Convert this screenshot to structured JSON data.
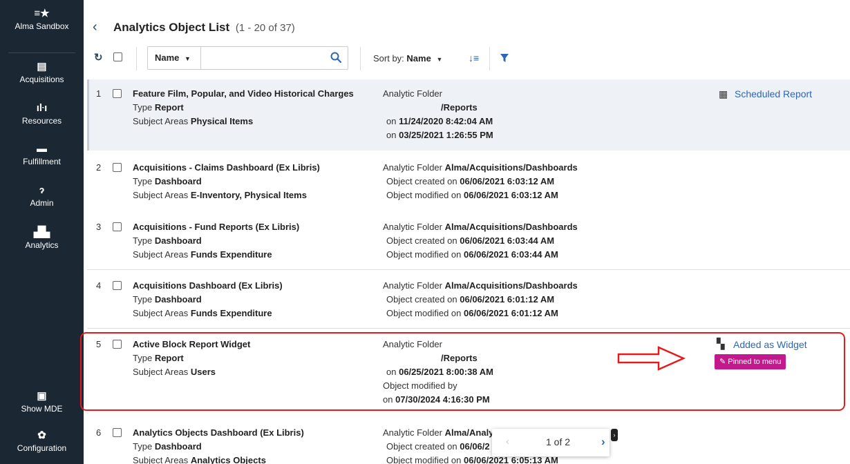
{
  "nav": {
    "brand": "Alma Sandbox",
    "items": [
      {
        "label": "Acquisitions",
        "icon": "ledger-icon"
      },
      {
        "label": "Resources",
        "icon": "books-icon"
      },
      {
        "label": "Fulfillment",
        "icon": "archive-box-icon"
      },
      {
        "label": "Admin",
        "icon": "key-icon"
      },
      {
        "label": "Analytics",
        "icon": "bar-chart-icon"
      }
    ],
    "bottom": [
      {
        "label": "Show MDE",
        "icon": "mde-book-icon"
      },
      {
        "label": "Configuration",
        "icon": "gear-icon"
      }
    ]
  },
  "header": {
    "title": "Analytics Object List",
    "count": "(1 - 20 of 37)"
  },
  "toolbar": {
    "search_field": "Name",
    "search_value": "",
    "sort_label": "Sort by:",
    "sort_value": "Name"
  },
  "labels": {
    "type": "Type",
    "subject_areas": "Subject Areas",
    "analytic_folder": "Analytic Folder",
    "created_on": "Object created on",
    "modified_on": "Object modified on",
    "on": "on",
    "modified_by": "Object modified by"
  },
  "rows": [
    {
      "num": "1",
      "name": "Feature Film, Popular, and Video Historical Charges",
      "type": "Report",
      "subjects": "Physical Items",
      "folder": "/Reports",
      "created": "11/24/2020 8:42:04 AM",
      "modified": "03/25/2021 1:26:55 PM",
      "badge": "Scheduled Report"
    },
    {
      "num": "2",
      "name": "Acquisitions - Claims Dashboard (Ex Libris)",
      "type": "Dashboard",
      "subjects": "E-Inventory, Physical Items",
      "folder": "Alma/Acquisitions/Dashboards",
      "created": "06/06/2021 6:03:12 AM",
      "modified": "06/06/2021 6:03:12 AM"
    },
    {
      "num": "3",
      "name": "Acquisitions - Fund Reports (Ex Libris)",
      "type": "Dashboard",
      "subjects": "Funds Expenditure",
      "folder": "Alma/Acquisitions/Dashboards",
      "created": "06/06/2021 6:03:44 AM",
      "modified": "06/06/2021 6:03:44 AM"
    },
    {
      "num": "4",
      "name": "Acquisitions Dashboard (Ex Libris)",
      "type": "Dashboard",
      "subjects": "Funds Expenditure",
      "folder": "Alma/Acquisitions/Dashboards",
      "created": "06/06/2021 6:01:12 AM",
      "modified": "06/06/2021 6:01:12 AM"
    },
    {
      "num": "5",
      "name": "Active Block Report Widget",
      "type": "Report",
      "subjects": "Users",
      "folder": "/Reports",
      "created": "06/25/2021 8:00:38 AM",
      "modified": "07/30/2024 4:16:30 PM",
      "badge": "Added as Widget",
      "tag": "Pinned to menu"
    },
    {
      "num": "6",
      "name": "Analytics Objects Dashboard (Ex Libris)",
      "type": "Dashboard",
      "subjects": "Analytics Objects",
      "folder": "Alma/Analy",
      "created": "06/06/2",
      "modified": "06/06/2021 6:05:13 AM"
    }
  ],
  "pager": {
    "text": "1 of 2"
  }
}
